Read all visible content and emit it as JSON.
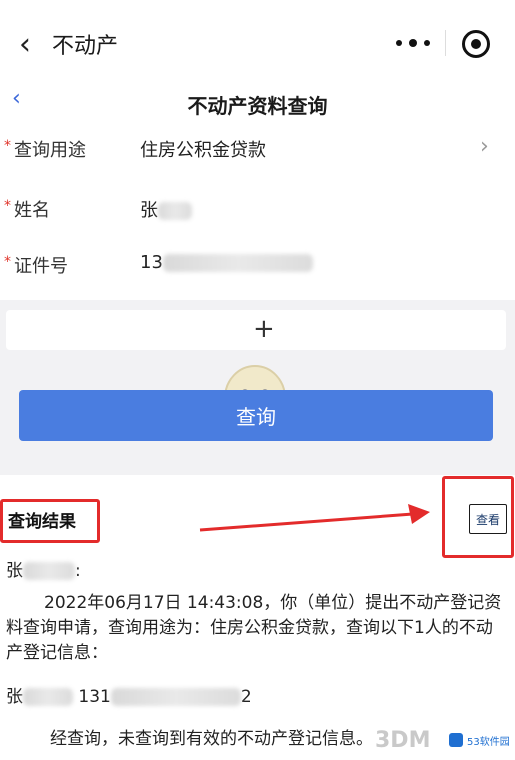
{
  "topbar": {
    "title": "不动产"
  },
  "subheader": {
    "back": "‹",
    "title": "不动产资料查询"
  },
  "form": {
    "purpose": {
      "label": "查询用途",
      "value": "住房公积金贷款"
    },
    "name": {
      "label": "姓名",
      "value": "张"
    },
    "id_number": {
      "label": "证件号",
      "value": "13"
    },
    "required_mark": "*"
  },
  "add": {
    "symbol": "+"
  },
  "query_button": {
    "label": "查询"
  },
  "result": {
    "heading": "查询结果",
    "view_button": "查看",
    "salutation_prefix": "张",
    "salutation_suffix": ":",
    "paragraph": "2022年06月17日 14:43:08，你（单位）提出不动产登记资料查询申请，查询用途为：住房公积金贷款，查询以下1人的不动产登记信息：",
    "person_prefix": "张",
    "person_mid": "131",
    "person_suffix": "2",
    "final": "经查询，未查询到有效的不动产登记信息。"
  },
  "watermark": {
    "text": "3DM",
    "logo": "53软件园"
  },
  "colors": {
    "accent": "#4a7de0",
    "annotation_red": "#e32b2b",
    "required_star": "#e0352b"
  }
}
